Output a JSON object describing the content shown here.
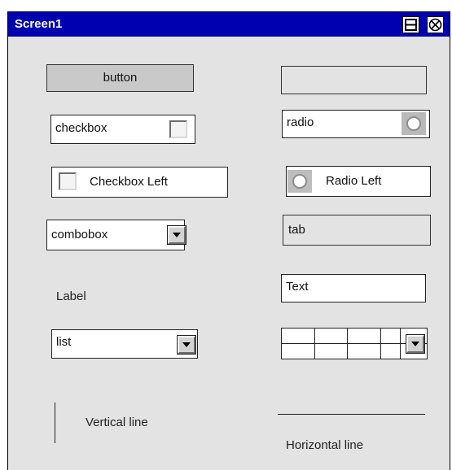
{
  "window": {
    "title": "Screen1"
  },
  "widgets": {
    "button_label": "button",
    "empty_button_label": "",
    "checkbox_label": "checkbox",
    "radio_label": "radio",
    "checkbox_left_label": "Checkbox Left",
    "radio_left_label": "Radio Left",
    "combobox_value": "combobox",
    "tab_label": "tab",
    "label_text": "Label",
    "text_field_value": "Text",
    "list_value": "list",
    "vertical_line_caption": "Vertical line",
    "horizontal_line_caption": "Horizontal line"
  },
  "icons": {
    "maximize": "maximize-icon",
    "close": "close-icon",
    "dropdown": "chevron-down-icon"
  },
  "colors": {
    "titlebar": "#0000b0",
    "window_bg": "#e3e3e3"
  }
}
